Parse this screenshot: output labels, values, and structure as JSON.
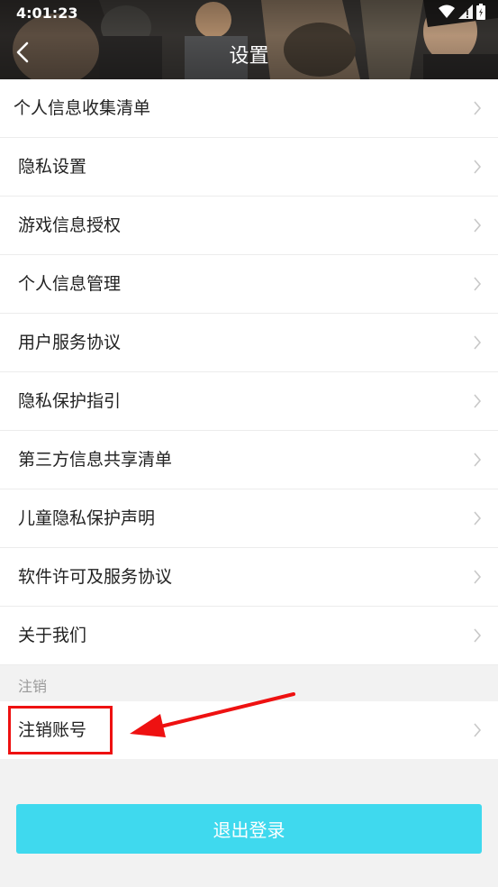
{
  "status_bar": {
    "time": "4:01:23"
  },
  "header": {
    "title": "设置"
  },
  "menu": {
    "items": [
      {
        "label": "个人信息收集清单"
      },
      {
        "label": "隐私设置"
      },
      {
        "label": "游戏信息授权"
      },
      {
        "label": "个人信息管理"
      },
      {
        "label": "用户服务协议"
      },
      {
        "label": "隐私保护指引"
      },
      {
        "label": "第三方信息共享清单"
      },
      {
        "label": "儿童隐私保护声明"
      },
      {
        "label": "软件许可及服务协议"
      },
      {
        "label": "关于我们"
      }
    ]
  },
  "cancel_section": {
    "header": "注销",
    "item_label": "注销账号"
  },
  "logout": {
    "label": "退出登录"
  },
  "colors": {
    "accent": "#3fd9ee",
    "annotation": "#ee1111"
  }
}
